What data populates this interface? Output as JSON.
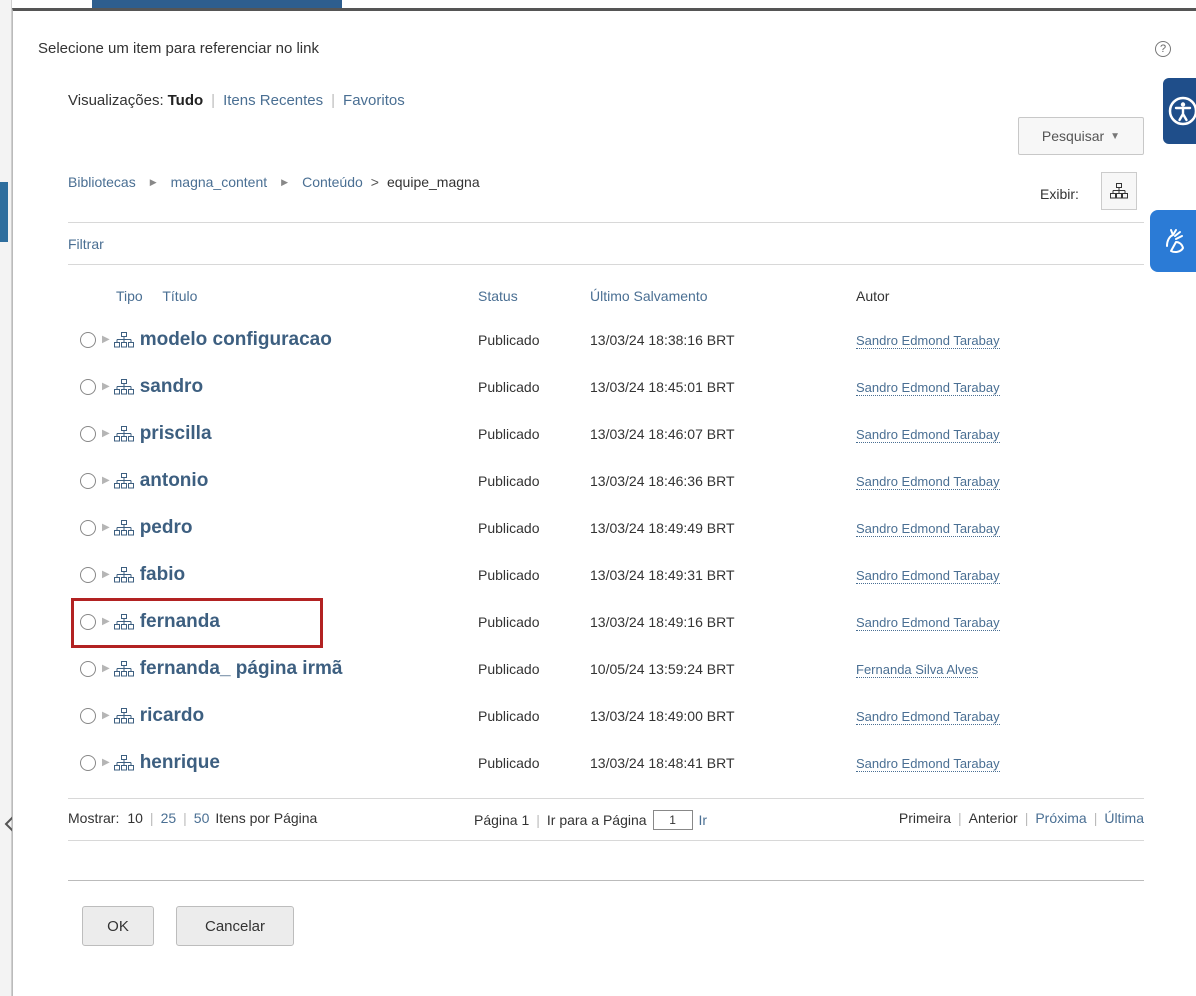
{
  "dialog": {
    "title": "Selecione um item para referenciar no link",
    "help_glyph": "?"
  },
  "views": {
    "label": "Visualizações:",
    "active": "Tudo",
    "recent": "Itens Recentes",
    "favorites": "Favoritos"
  },
  "search": {
    "label": "Pesquisar"
  },
  "breadcrumb": {
    "items": [
      "Bibliotecas",
      "magna_content",
      "Conteúdo"
    ],
    "current": "equipe_magna"
  },
  "display": {
    "label": "Exibir:"
  },
  "filter": {
    "label": "Filtrar"
  },
  "table": {
    "headers": {
      "type": "Tipo",
      "title": "Título",
      "status": "Status",
      "saved": "Último Salvamento",
      "author": "Autor"
    },
    "rows": [
      {
        "title": "modelo configuracao",
        "status": "Publicado",
        "saved": "13/03/24 18:38:16 BRT",
        "author": "Sandro Edmond Tarabay"
      },
      {
        "title": "sandro",
        "status": "Publicado",
        "saved": "13/03/24 18:45:01 BRT",
        "author": "Sandro Edmond Tarabay"
      },
      {
        "title": "priscilla",
        "status": "Publicado",
        "saved": "13/03/24 18:46:07 BRT",
        "author": "Sandro Edmond Tarabay"
      },
      {
        "title": "antonio",
        "status": "Publicado",
        "saved": "13/03/24 18:46:36 BRT",
        "author": "Sandro Edmond Tarabay"
      },
      {
        "title": "pedro",
        "status": "Publicado",
        "saved": "13/03/24 18:49:49 BRT",
        "author": "Sandro Edmond Tarabay"
      },
      {
        "title": "fabio",
        "status": "Publicado",
        "saved": "13/03/24 18:49:31 BRT",
        "author": "Sandro Edmond Tarabay"
      },
      {
        "title": "fernanda",
        "status": "Publicado",
        "saved": "13/03/24 18:49:16 BRT",
        "author": "Sandro Edmond Tarabay"
      },
      {
        "title": "fernanda_ página irmã",
        "status": "Publicado",
        "saved": "10/05/24 13:59:24 BRT",
        "author": "Fernanda Silva Alves"
      },
      {
        "title": "ricardo",
        "status": "Publicado",
        "saved": "13/03/24 18:49:00 BRT",
        "author": "Sandro Edmond Tarabay"
      },
      {
        "title": "henrique",
        "status": "Publicado",
        "saved": "13/03/24 18:48:41 BRT",
        "author": "Sandro Edmond Tarabay"
      }
    ]
  },
  "pager": {
    "show_label": "Mostrar:",
    "sizes": [
      "10",
      "25",
      "50"
    ],
    "per_page_label": "Itens por Página",
    "page_label": "Página 1",
    "goto_label": "Ir para a Página",
    "goto_value": "1",
    "go_label": "Ir",
    "first": "Primeira",
    "prev": "Anterior",
    "next": "Próxima",
    "last": "Última"
  },
  "buttons": {
    "ok": "OK",
    "cancel": "Cancelar"
  },
  "colors": {
    "link": "#4a6f93",
    "highlight": "#b22222",
    "a11y_dark": "#1f4e8a",
    "a11y_light": "#2b7bd6"
  },
  "icons": {
    "tree": "sitemap-icon",
    "a11y": "accessibility-icon",
    "sign": "sign-language-icon"
  }
}
